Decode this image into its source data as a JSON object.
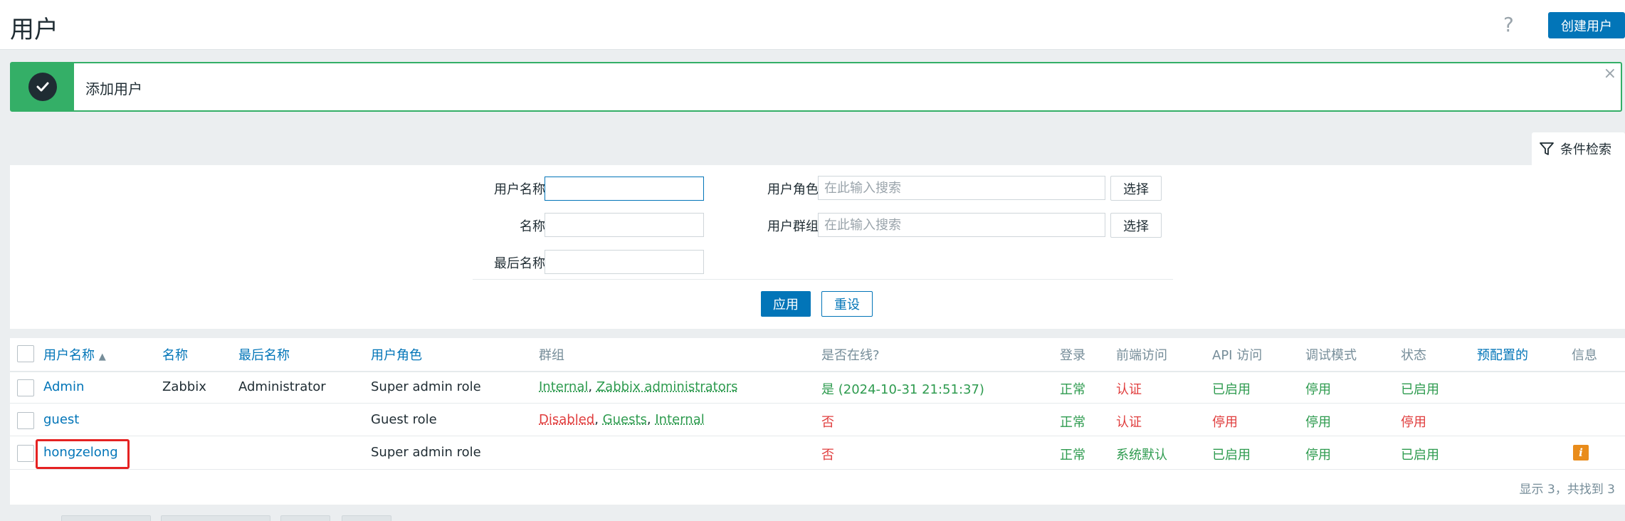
{
  "header": {
    "title": "用户",
    "help_icon": "question-icon",
    "create_label": "创建用户"
  },
  "message": {
    "text": "添加用户",
    "close": "×",
    "icon": "check-icon"
  },
  "filter": {
    "tab_label": "条件检索",
    "username_label": "用户名称",
    "username_value": "",
    "name_label": "名称",
    "name_value": "",
    "lastname_label": "最后名称",
    "lastname_value": "",
    "role_label": "用户角色",
    "role_placeholder": "在此输入搜索",
    "group_label": "用户群组",
    "group_placeholder": "在此输入搜索",
    "select_label": "选择",
    "apply_label": "应用",
    "reset_label": "重设"
  },
  "table": {
    "headers": {
      "username": "用户名称",
      "sort_indicator": "▲",
      "name": "名称",
      "lastname": "最后名称",
      "role": "用户角色",
      "groups": "群组",
      "online": "是否在线?",
      "login": "登录",
      "frontend": "前端访问",
      "api": "API 访问",
      "debug": "调试模式",
      "status": "状态",
      "provisioned": "预配置的",
      "info": "信息"
    },
    "rows": [
      {
        "username": "Admin",
        "name": "Zabbix",
        "lastname": "Administrator",
        "role": "Super admin role",
        "groups": [
          "Internal",
          "Zabbix administrators"
        ],
        "online": "是 (2024-10-31 21:51:37)",
        "login": "正常",
        "frontend": "认证",
        "api": "已启用",
        "debug": "停用",
        "status": "已启用"
      },
      {
        "username": "guest",
        "name": "",
        "lastname": "",
        "role": "Guest role",
        "groups": [
          "Disabled",
          "Guests",
          "Internal"
        ],
        "online": "否",
        "login": "正常",
        "frontend": "认证",
        "api": "停用",
        "debug": "停用",
        "status": "停用"
      },
      {
        "username": "hongzelong",
        "name": "",
        "lastname": "",
        "role": "Super admin role",
        "groups": [],
        "online": "否",
        "login": "正常",
        "frontend": "系统默认",
        "api": "已启用",
        "debug": "停用",
        "status": "已启用",
        "info": "i"
      }
    ],
    "separator": ", ",
    "footer": "显示 3，共找到 3"
  },
  "colors": {
    "accent": "#0275b8",
    "success": "#34af67",
    "green_text": "#2e9b4f",
    "red_text": "#e03d3d",
    "highlight": "#e52222"
  }
}
